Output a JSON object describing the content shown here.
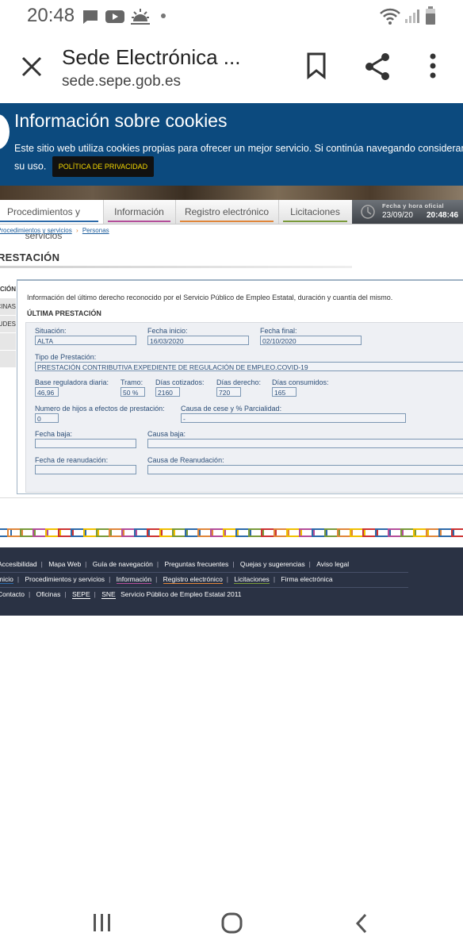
{
  "status_bar": {
    "time": "20:48"
  },
  "toolbar": {
    "title": "Sede Electrónica ...",
    "url": "sede.sepe.gob.es"
  },
  "cookie": {
    "title": "Información sobre cookies",
    "text": "Este sitio web utiliza cookies propias para ofrecer un mejor servicio. Si continúa navegando consideramos que acepta",
    "text2": "su uso.",
    "policy_button": "POLÍTICA DE PRIVACIDAD",
    "accent": "A"
  },
  "nav": {
    "tabs": [
      "Procedimientos y servicios",
      "Información",
      "Registro electrónico",
      "Licitaciones"
    ],
    "tab_colors": [
      "#2d6aa9",
      "#b44e9a",
      "#e0863a",
      "#7a9a3a"
    ]
  },
  "clock": {
    "label": "Fecha y hora oficial",
    "date": "23/09/20",
    "time": "20:48:46"
  },
  "breadcrumb": {
    "items": [
      "Procedimientos y servicios",
      "Personas"
    ],
    "sep": "›"
  },
  "page_title": "PRESTACIÓN",
  "side_menu": [
    "PRESTACIÓN",
    "OFICINAS",
    "SOLICITUDES",
    "",
    ""
  ],
  "main": {
    "intro": "Información del último derecho reconocido por el Servicio Público de Empleo Estatal, duración y cuantía del mismo.",
    "section_title": "ÚLTIMA PRESTACIÓN",
    "fields": {
      "situacion": {
        "label": "Situación:",
        "value": "ALTA"
      },
      "fecha_inicio": {
        "label": "Fecha inicio:",
        "value": "16/03/2020"
      },
      "fecha_final": {
        "label": "Fecha final:",
        "value": "02/10/2020"
      },
      "tipo": {
        "label": "Tipo de Prestación:",
        "value": "PRESTACIÓN CONTRIBUTIVA EXPEDIENTE DE REGULACIÓN DE EMPLEO.COVID-19"
      },
      "base": {
        "label": "Base reguladora diaria:",
        "value": "46,96"
      },
      "tramo": {
        "label": "Tramo:",
        "value": "50 %"
      },
      "dias_cotizados": {
        "label": "Días cotizados:",
        "value": "2160"
      },
      "dias_derecho": {
        "label": "Días derecho:",
        "value": "720"
      },
      "dias_consumidos": {
        "label": "Días consumidos:",
        "value": "165"
      },
      "hijos": {
        "label": "Numero de hijos a efectos de prestación:",
        "value": "0"
      },
      "causa_cese": {
        "label": "Causa de cese y % Parcialidad:",
        "value": "-"
      },
      "fecha_baja": {
        "label": "Fecha baja:",
        "value": ""
      },
      "causa_baja": {
        "label": "Causa baja:",
        "value": ""
      },
      "fecha_reanudacion": {
        "label": "Fecha de reanudación:",
        "value": ""
      },
      "causa_reanudacion": {
        "label": "Causa de Reanudación:",
        "value": ""
      }
    }
  },
  "footer": {
    "row1": [
      "Accesibilidad",
      "Mapa Web",
      "Guía de navegación",
      "Preguntas frecuentes",
      "Quejas y sugerencias",
      "Aviso legal"
    ],
    "row2": [
      "Inicio",
      "Procedimientos y servicios",
      "Información",
      "Registro electrónico",
      "Licitaciones",
      "Firma electrónica"
    ],
    "row3": [
      "Contacto",
      "Oficinas",
      "SEPE",
      "SNE"
    ],
    "copyright": "Servicio Público de Empleo Estatal 2011"
  },
  "colors": {
    "cookie_bg": "#0c4a7e",
    "footer_bg": "#2a3244",
    "field_text": "#2d4f78",
    "policy_text": "#f5d800"
  }
}
